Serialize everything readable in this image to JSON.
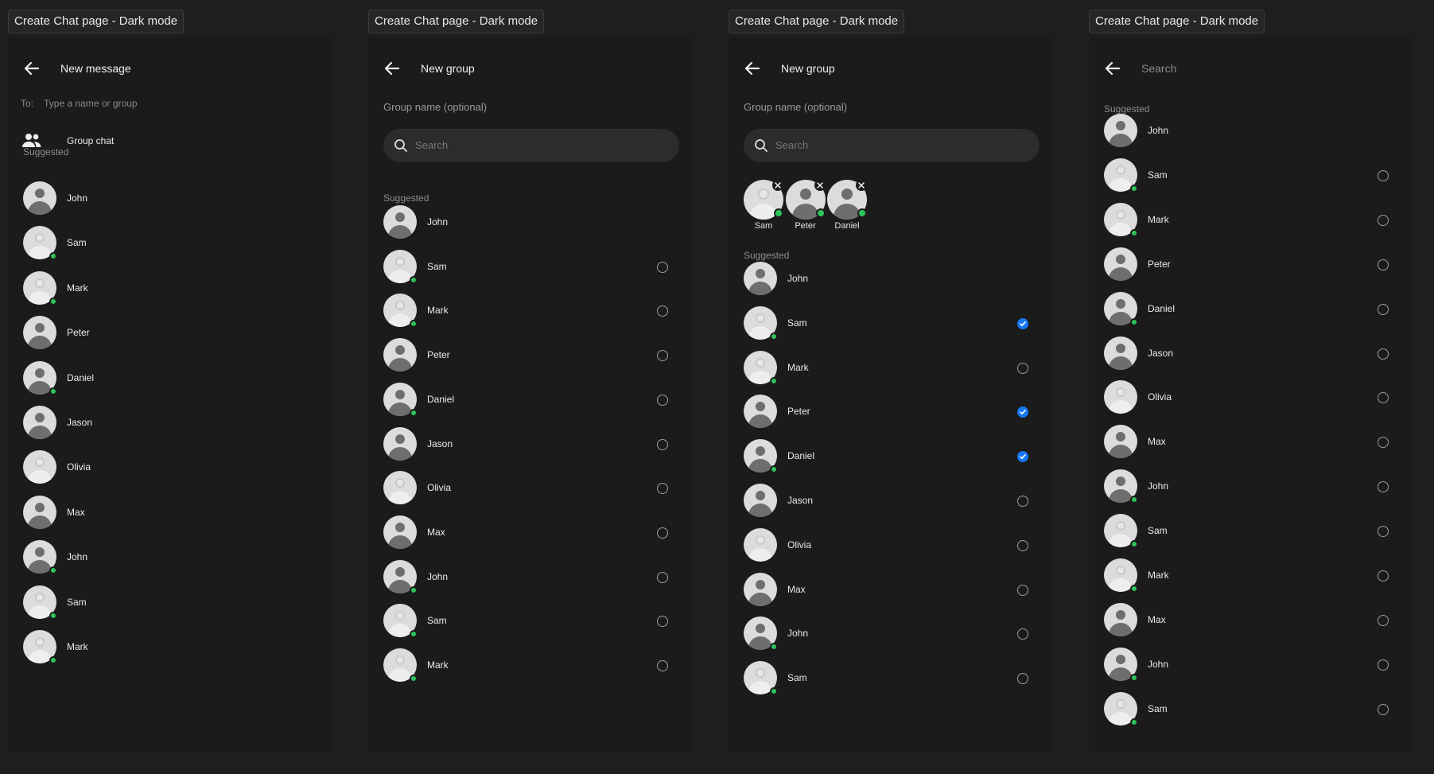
{
  "frames": [
    {
      "label": "Create Chat page - Dark mode",
      "title": "New message",
      "to_label": "To:",
      "to_placeholder": "Type a name or group",
      "group_chat_label": "Group chat",
      "suggested_label": "Suggested",
      "contacts": [
        {
          "name": "John",
          "online": false,
          "light": false
        },
        {
          "name": "Sam",
          "online": true,
          "light": true
        },
        {
          "name": "Mark",
          "online": true,
          "light": true
        },
        {
          "name": "Peter",
          "online": false,
          "light": false
        },
        {
          "name": "Daniel",
          "online": true,
          "light": false
        },
        {
          "name": "Jason",
          "online": false,
          "light": false
        },
        {
          "name": "Olivia",
          "online": false,
          "light": true
        },
        {
          "name": "Max",
          "online": false,
          "light": false
        },
        {
          "name": "John",
          "online": true,
          "light": false
        },
        {
          "name": "Sam",
          "online": true,
          "light": true
        },
        {
          "name": "Mark",
          "online": true,
          "light": true
        }
      ]
    },
    {
      "label": "Create Chat page - Dark mode",
      "title": "New group",
      "group_name_label": "Group name (optional)",
      "search_placeholder": "Search",
      "suggested_label": "Suggested",
      "contacts": [
        {
          "name": "John",
          "online": false,
          "light": false,
          "radio": "none"
        },
        {
          "name": "Sam",
          "online": true,
          "light": true,
          "radio": "unchecked"
        },
        {
          "name": "Mark",
          "online": true,
          "light": true,
          "radio": "unchecked"
        },
        {
          "name": "Peter",
          "online": false,
          "light": false,
          "radio": "unchecked"
        },
        {
          "name": "Daniel",
          "online": true,
          "light": false,
          "radio": "unchecked"
        },
        {
          "name": "Jason",
          "online": false,
          "light": false,
          "radio": "unchecked"
        },
        {
          "name": "Olivia",
          "online": false,
          "light": true,
          "radio": "unchecked"
        },
        {
          "name": "Max",
          "online": false,
          "light": false,
          "radio": "unchecked"
        },
        {
          "name": "John",
          "online": true,
          "light": false,
          "radio": "unchecked"
        },
        {
          "name": "Sam",
          "online": true,
          "light": true,
          "radio": "unchecked"
        },
        {
          "name": "Mark",
          "online": true,
          "light": true,
          "radio": "unchecked"
        }
      ]
    },
    {
      "label": "Create Chat page - Dark mode",
      "title": "New group",
      "group_name_label": "Group name (optional)",
      "search_placeholder": "Search",
      "selected": [
        {
          "name": "Sam",
          "light": true
        },
        {
          "name": "Peter",
          "light": false
        },
        {
          "name": "Daniel",
          "light": false
        }
      ],
      "suggested_label": "Suggested",
      "contacts": [
        {
          "name": "John",
          "online": false,
          "light": false,
          "radio": "none"
        },
        {
          "name": "Sam",
          "online": true,
          "light": true,
          "radio": "checked"
        },
        {
          "name": "Mark",
          "online": true,
          "light": true,
          "radio": "unchecked"
        },
        {
          "name": "Peter",
          "online": false,
          "light": false,
          "radio": "checked"
        },
        {
          "name": "Daniel",
          "online": true,
          "light": false,
          "radio": "checked"
        },
        {
          "name": "Jason",
          "online": false,
          "light": false,
          "radio": "unchecked"
        },
        {
          "name": "Olivia",
          "online": false,
          "light": true,
          "radio": "unchecked"
        },
        {
          "name": "Max",
          "online": false,
          "light": false,
          "radio": "unchecked"
        },
        {
          "name": "John",
          "online": true,
          "light": false,
          "radio": "unchecked"
        },
        {
          "name": "Sam",
          "online": true,
          "light": true,
          "radio": "unchecked"
        }
      ]
    },
    {
      "label": "Create Chat page - Dark mode",
      "search_placeholder": "Search",
      "suggested_label": "Suggested",
      "contacts": [
        {
          "name": "John",
          "online": false,
          "light": false,
          "radio": "none"
        },
        {
          "name": "Sam",
          "online": true,
          "light": true,
          "radio": "unchecked"
        },
        {
          "name": "Mark",
          "online": true,
          "light": true,
          "radio": "unchecked"
        },
        {
          "name": "Peter",
          "online": false,
          "light": false,
          "radio": "unchecked"
        },
        {
          "name": "Daniel",
          "online": true,
          "light": false,
          "radio": "unchecked"
        },
        {
          "name": "Jason",
          "online": false,
          "light": false,
          "radio": "unchecked"
        },
        {
          "name": "Olivia",
          "online": false,
          "light": true,
          "radio": "unchecked"
        },
        {
          "name": "Max",
          "online": false,
          "light": false,
          "radio": "unchecked"
        },
        {
          "name": "John",
          "online": true,
          "light": false,
          "radio": "unchecked"
        },
        {
          "name": "Sam",
          "online": true,
          "light": true,
          "radio": "unchecked"
        },
        {
          "name": "Mark",
          "online": true,
          "light": true,
          "radio": "unchecked"
        },
        {
          "name": "Max",
          "online": false,
          "light": false,
          "radio": "unchecked"
        },
        {
          "name": "John",
          "online": true,
          "light": false,
          "radio": "unchecked"
        },
        {
          "name": "Sam",
          "online": true,
          "light": true,
          "radio": "unchecked"
        }
      ]
    }
  ],
  "colors": {
    "background": "#1e1e1e",
    "panel": "#1b1b1b",
    "online": "#2ec35a",
    "checked": "#1877f2"
  },
  "icons": [
    "back-arrow-icon",
    "group-icon",
    "search-icon",
    "remove-icon",
    "checkmark-icon"
  ]
}
